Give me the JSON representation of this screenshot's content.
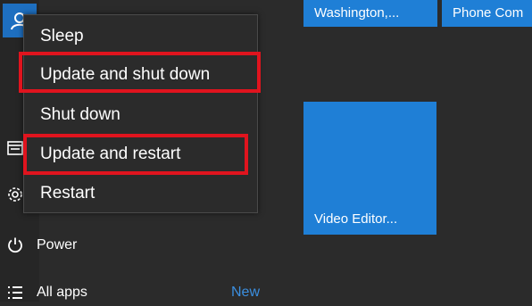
{
  "power_menu": {
    "items": [
      {
        "label": "Sleep"
      },
      {
        "label": "Update and shut down"
      },
      {
        "label": "Shut down"
      },
      {
        "label": "Update and restart"
      },
      {
        "label": "Restart"
      }
    ]
  },
  "sidebar": {
    "power_label": "Power",
    "all_apps_label": "All apps",
    "new_badge": "New"
  },
  "tiles": {
    "weather": "Washington,...",
    "phone": "Phone Com",
    "video_editor": "Video Editor..."
  },
  "colors": {
    "accent": "#1f7fd6",
    "highlight": "#e0141e",
    "menu_bg": "#2b2b2b"
  },
  "icons": [
    "user-avatar-icon",
    "file-explorer-icon",
    "settings-gear-icon",
    "power-icon",
    "all-apps-list-icon"
  ]
}
